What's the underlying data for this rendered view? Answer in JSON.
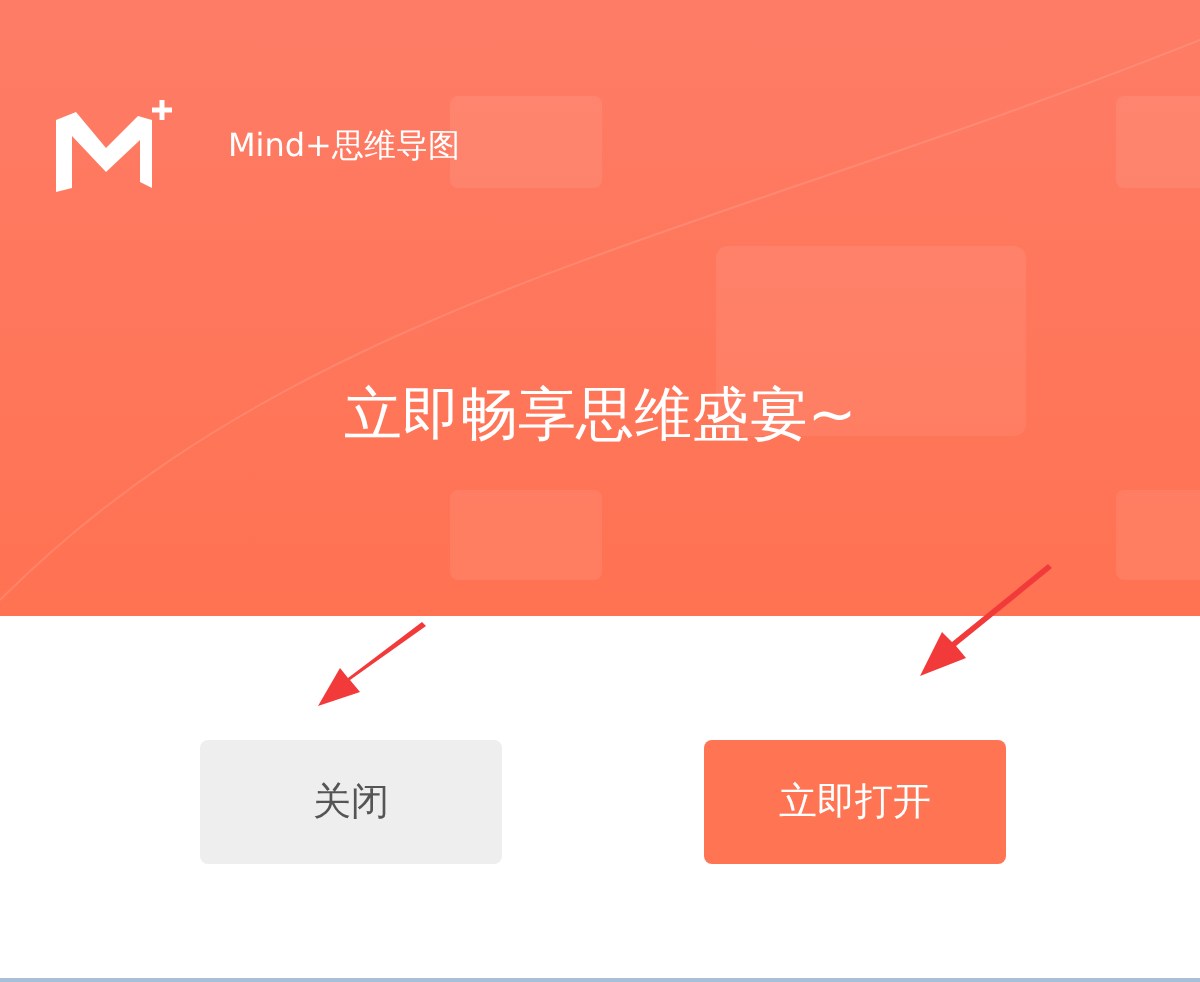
{
  "app_name": "Mind+思维导图",
  "heading": "立即畅享思维盛宴~",
  "buttons": [
    {
      "label": "关闭",
      "kind": "secondary"
    },
    {
      "label": "立即打开",
      "kind": "primary"
    }
  ]
}
